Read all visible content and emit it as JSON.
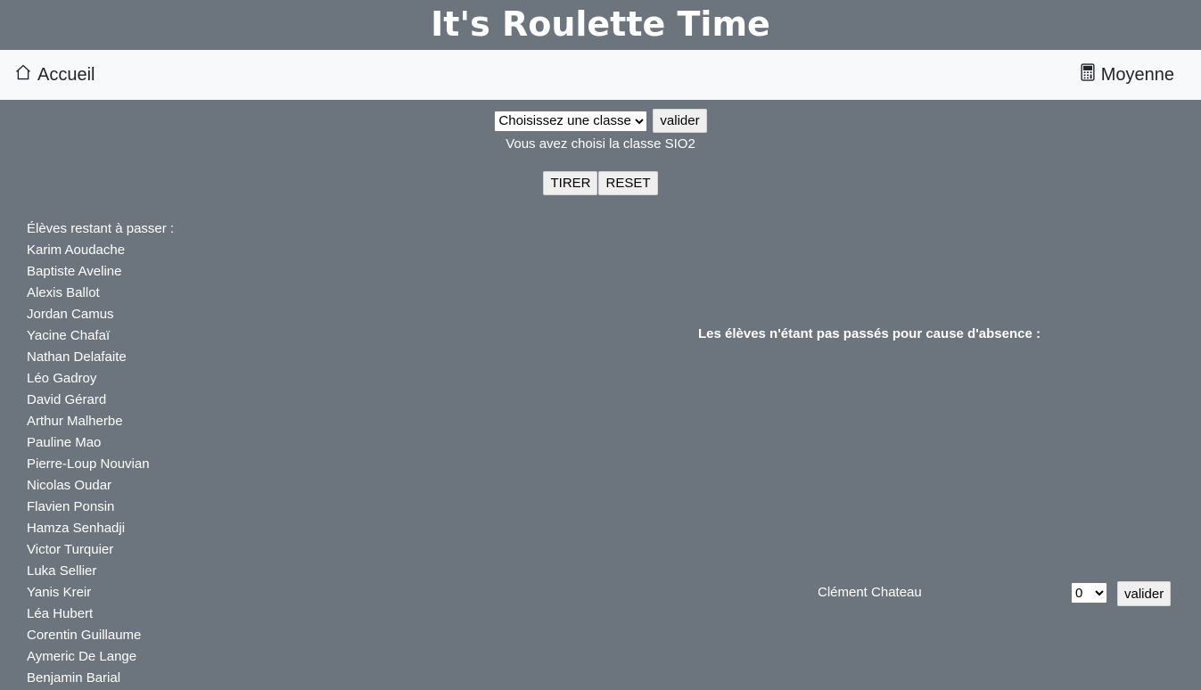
{
  "header": {
    "title": "It's Roulette Time"
  },
  "nav": {
    "home_label": "Accueil",
    "average_label": "Moyenne",
    "home_icon": "house-icon",
    "average_icon": "calculator-icon"
  },
  "class_form": {
    "select_value": "Choisissez une classe",
    "validate_label": "valider"
  },
  "chosen_text": "Vous avez choisi la classe SIO2",
  "actions": {
    "draw_label": "TIRER",
    "reset_label": "RESET"
  },
  "remaining": {
    "heading": "Élèves restant à passer :",
    "students": [
      "Karim Aoudache",
      "Baptiste Aveline",
      "Alexis Ballot",
      "Jordan Camus",
      "Yacine Chafaï",
      "Nathan Delafaite",
      "Léo Gadroy",
      "David Gérard",
      "Arthur Malherbe",
      "Pauline Mao",
      "Pierre-Loup Nouvian",
      "Nicolas Oudar",
      "Flavien Ponsin",
      "Hamza Senhadji",
      "Victor Turquier",
      "Luka Sellier",
      "Yanis Kreir",
      "Léa Hubert",
      "Corentin Guillaume",
      "Aymeric De Lange",
      "Benjamin Barial"
    ]
  },
  "absence": {
    "heading": "Les élèves n'étant pas passés pour cause d'absence :",
    "student_name": "Clément Chateau",
    "grade_value": "0",
    "validate_label": "valider"
  },
  "colors": {
    "background": "#6c757d",
    "navbar": "#f8f9fa"
  }
}
